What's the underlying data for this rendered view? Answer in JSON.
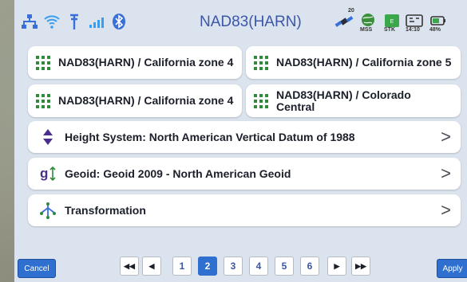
{
  "header": {
    "title": "NAD83(HARN)",
    "status": {
      "sat_count": "20",
      "mode": "MSS",
      "time": "14:10",
      "battery": "48%",
      "stk": "STK"
    }
  },
  "systems": [
    {
      "label": "NAD83(HARN) / California zone 4"
    },
    {
      "label": "NAD83(HARN) / California zone 5"
    },
    {
      "label": "NAD83(HARN) / California zone 4"
    },
    {
      "label": "NAD83(HARN) / Colorado Central"
    }
  ],
  "rows": {
    "height": "Height System: North American Vertical Datum of 1988",
    "geoid": "Geoid: Geoid 2009 - North American Geoid",
    "transformation": "Transformation"
  },
  "footer": {
    "cancel": "Cancel",
    "apply": "Apply",
    "pages": [
      "1",
      "2",
      "3",
      "4",
      "5",
      "6"
    ],
    "current_page": "2"
  }
}
